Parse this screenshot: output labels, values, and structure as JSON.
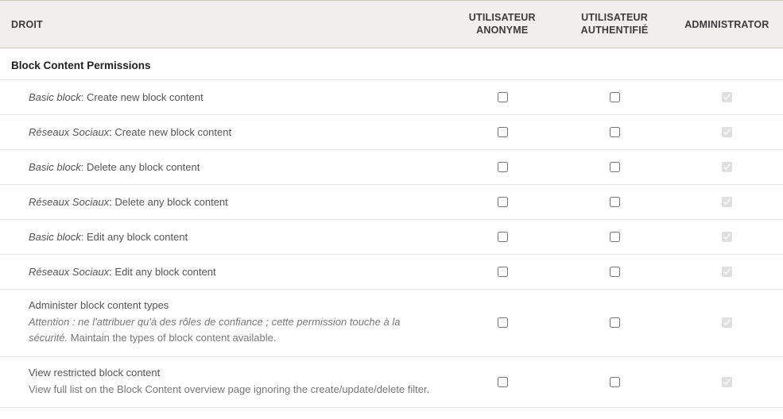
{
  "columns": {
    "permission": "Droit",
    "anonymous_l1": "Utilisateur",
    "anonymous_l2": "anonyme",
    "authenticated_l1": "Utilisateur",
    "authenticated_l2": "authentifié",
    "administrator": "Administrator"
  },
  "section": {
    "title": "Block Content Permissions"
  },
  "rows": [
    {
      "prefix": "Basic block",
      "sep": ": ",
      "label": "Create new block content",
      "anon": false,
      "auth": false,
      "admin": true,
      "admin_locked": true
    },
    {
      "prefix": "Réseaux Sociaux",
      "sep": ": ",
      "label": "Create new block content",
      "anon": false,
      "auth": false,
      "admin": true,
      "admin_locked": true
    },
    {
      "prefix": "Basic block",
      "sep": ": ",
      "label": "Delete any block content",
      "anon": false,
      "auth": false,
      "admin": true,
      "admin_locked": true
    },
    {
      "prefix": "Réseaux Sociaux",
      "sep": ": ",
      "label": "Delete any block content",
      "anon": false,
      "auth": false,
      "admin": true,
      "admin_locked": true
    },
    {
      "prefix": "Basic block",
      "sep": ": ",
      "label": "Edit any block content",
      "anon": false,
      "auth": false,
      "admin": true,
      "admin_locked": true
    },
    {
      "prefix": "Réseaux Sociaux",
      "sep": ": ",
      "label": "Edit any block content",
      "anon": false,
      "auth": false,
      "admin": true,
      "admin_locked": true
    },
    {
      "label": "Administer block content types",
      "desc_warn": "Attention : ne l'attribuer qu'à des rôles de confiance ; cette permission touche à la sécurité.",
      "desc_rest": " Maintain the types of block content available.",
      "anon": false,
      "auth": false,
      "admin": true,
      "admin_locked": true
    },
    {
      "label": "View restricted block content",
      "desc_rest": "View full list on the Block Content overview page ignoring the create/update/delete filter.",
      "anon": false,
      "auth": false,
      "admin": true,
      "admin_locked": true
    }
  ]
}
